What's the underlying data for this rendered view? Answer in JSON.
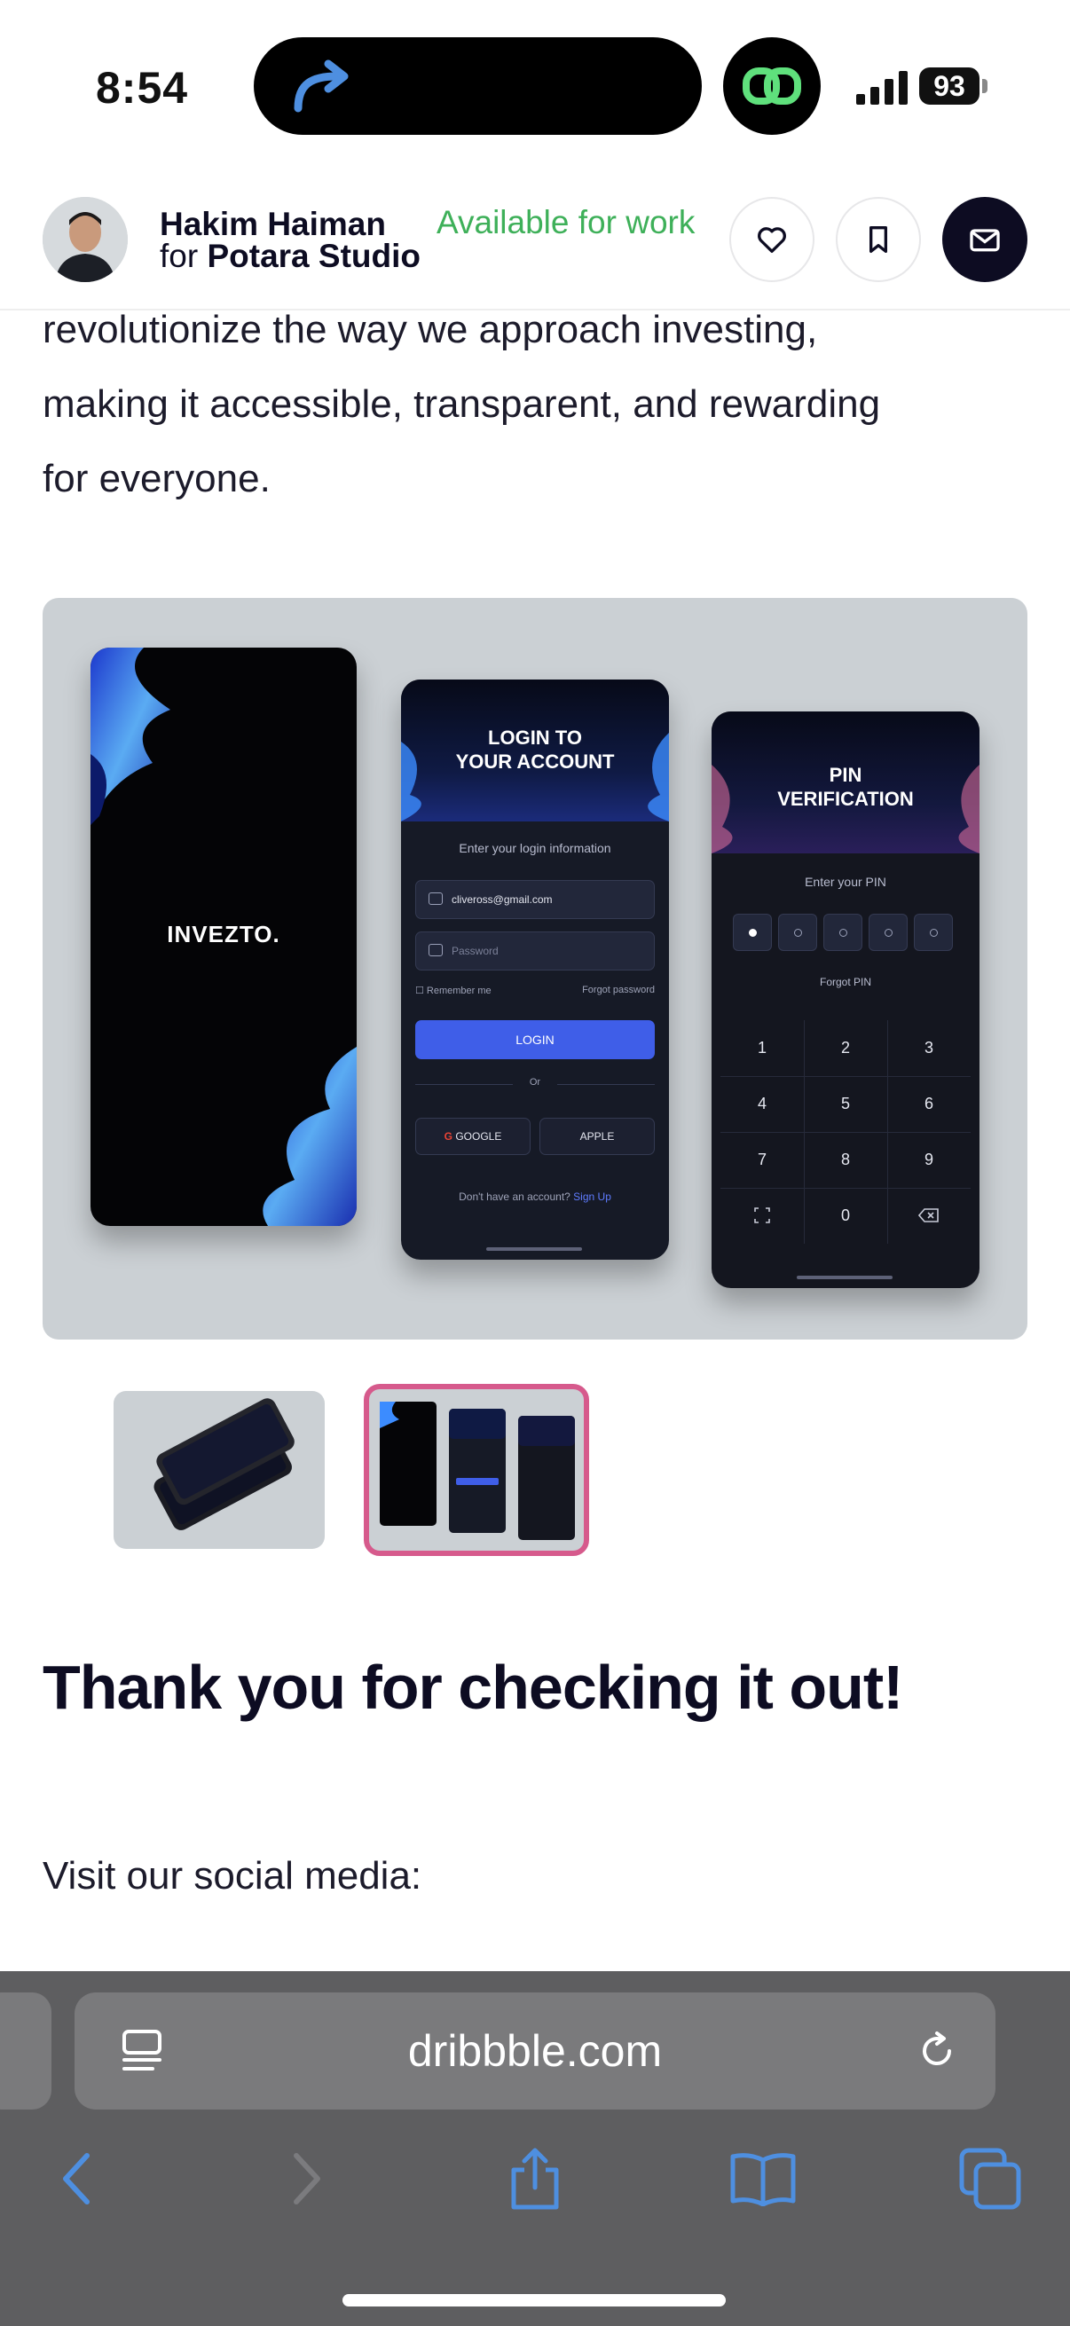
{
  "status_bar": {
    "time": "8:54",
    "battery": "93"
  },
  "author": {
    "name": "Hakim Haiman",
    "team_prefix": "for",
    "team_name": "Potara Studio",
    "availability": "Available for work"
  },
  "description_lines": [
    "revolutionize the way we approach investing,",
    "making it accessible, transparent, and rewarding",
    "for everyone."
  ],
  "preview": {
    "splash_brand": "INVEZTO.",
    "login": {
      "title_line1": "LOGIN TO",
      "title_line2": "YOUR ACCOUNT",
      "subtitle": "Enter your login information",
      "email_value": "cliveross@gmail.com",
      "password_placeholder": "Password",
      "remember": "Remember me",
      "forgot": "Forgot password",
      "button": "LOGIN",
      "or": "Or",
      "google": "GOOGLE",
      "apple": "APPLE",
      "signup_prompt": "Don't have an account?",
      "signup_link": "Sign Up"
    },
    "pin": {
      "title_line1": "PIN",
      "title_line2": "VERIFICATION",
      "subtitle": "Enter your PIN",
      "forgot": "Forgot PIN",
      "keys": [
        "1",
        "2",
        "3",
        "4",
        "5",
        "6",
        "7",
        "8",
        "9",
        "0"
      ]
    }
  },
  "thanks_heading": "Thank you for checking it out!",
  "social_text": "Visit our social media:",
  "browser": {
    "url": "dribbble.com"
  },
  "colors": {
    "availability": "#3eb059",
    "accent_pink": "#d65a8c",
    "login_button": "#3f5ee8"
  }
}
